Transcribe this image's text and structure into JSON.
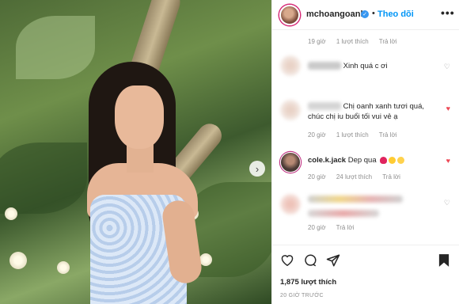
{
  "post": {
    "username": "mchoangoanh",
    "follow_label": "Theo dõi",
    "more_label": "•••",
    "next_label": "›"
  },
  "comments": {
    "c0": {
      "age": "19 giờ",
      "likes": "1 lượt thích",
      "reply": "Trả lời"
    },
    "c1": {
      "text": "Xinh quá c ơi",
      "heart": "♡"
    },
    "c2": {
      "text_line1": "Chị oanh xanh tươi quá,",
      "text_line2": "chúc chị iu buổi tối vui vẻ ạ",
      "age": "20 giờ",
      "likes": "1 lượt thích",
      "reply": "Trả lời",
      "heart": "♥"
    },
    "c3": {
      "username": "cole.k.jack",
      "text": "Dep qua",
      "age": "20 giờ",
      "likes": "24 lượt thích",
      "reply": "Trả lời",
      "heart": "♥"
    },
    "c4": {
      "age": "20 giờ",
      "reply": "Trả lời",
      "heart": "♡"
    }
  },
  "footer": {
    "likes": "1,875 lượt thích",
    "time": "20 GIỜ TRƯỚC",
    "icons": [
      "heart-outline",
      "comment-bubble",
      "share-plane",
      "bookmark"
    ]
  },
  "colors": {
    "accent": "#0095f6",
    "like_red": "#ed4956",
    "muted": "#8e8e8e"
  }
}
